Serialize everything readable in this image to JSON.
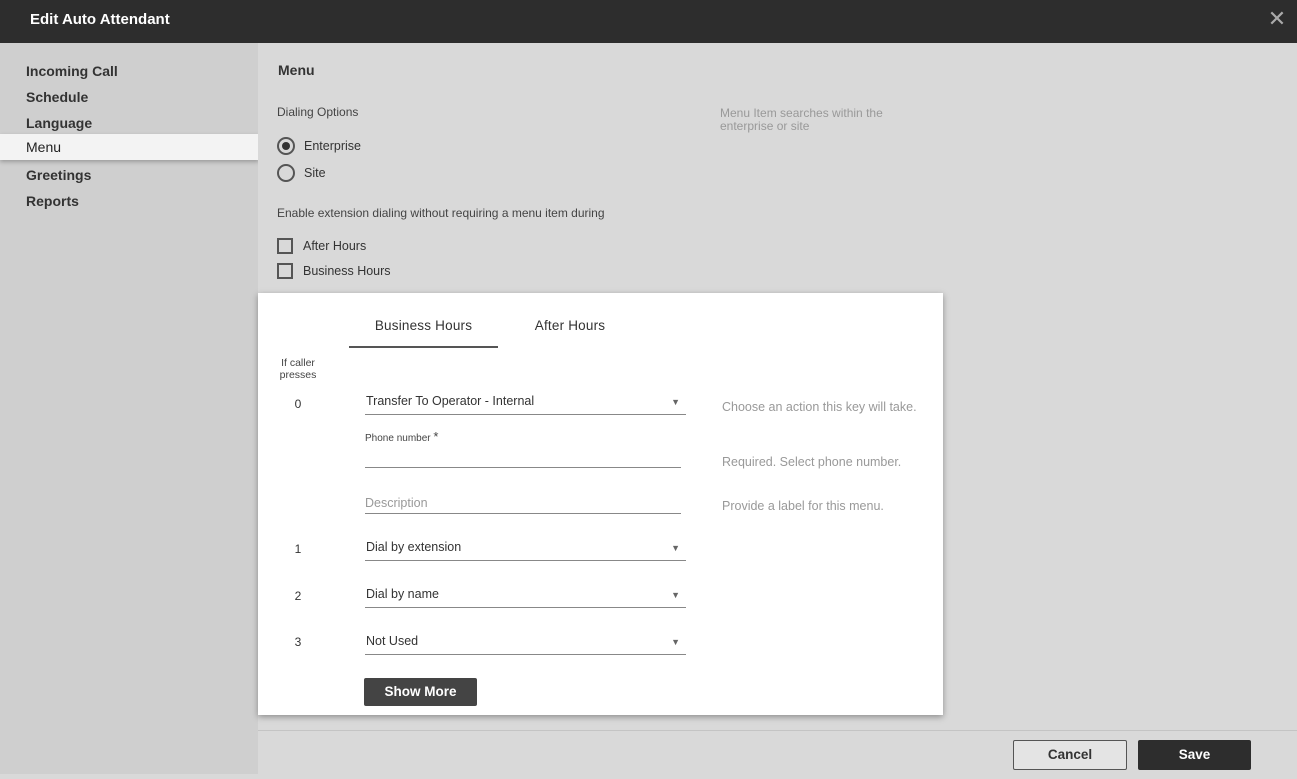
{
  "window": {
    "title": "Edit Auto Attendant",
    "close_glyph": "✕"
  },
  "sidebar": {
    "items": [
      {
        "label": "Incoming Call"
      },
      {
        "label": "Schedule"
      },
      {
        "label": "Language"
      },
      {
        "label": "Menu",
        "active": true
      },
      {
        "label": "Greetings"
      },
      {
        "label": "Reports"
      }
    ]
  },
  "main": {
    "section_title": "Menu",
    "dialing_options": {
      "label": "Dialing Options",
      "hint": "Menu Item searches within the enterprise or site",
      "options": [
        {
          "label": "Enterprise",
          "selected": true
        },
        {
          "label": "Site",
          "selected": false
        }
      ]
    },
    "extension_dialing": {
      "label": "Enable extension dialing without requiring a menu item during",
      "options": [
        {
          "label": "After Hours",
          "checked": false
        },
        {
          "label": "Business Hours",
          "checked": false
        }
      ]
    }
  },
  "menu_card": {
    "tabs": [
      {
        "label": "Business Hours",
        "active": true
      },
      {
        "label": "After Hours",
        "active": false
      }
    ],
    "column_header": "If caller presses",
    "rows": [
      {
        "key": "0",
        "action": "Transfer To Operator - Internal",
        "hint": "Choose an action this key will take."
      },
      {
        "key": "1",
        "action": "Dial by extension"
      },
      {
        "key": "2",
        "action": "Dial by name"
      },
      {
        "key": "3",
        "action": "Not Used"
      }
    ],
    "phone_number": {
      "label": "Phone number",
      "required_mark": "*",
      "value": "",
      "hint": "Required. Select phone number."
    },
    "description": {
      "placeholder": "Description",
      "value": "",
      "hint": "Provide a label for this menu."
    },
    "show_more_label": "Show More"
  },
  "footer": {
    "cancel_label": "Cancel",
    "save_label": "Save"
  }
}
